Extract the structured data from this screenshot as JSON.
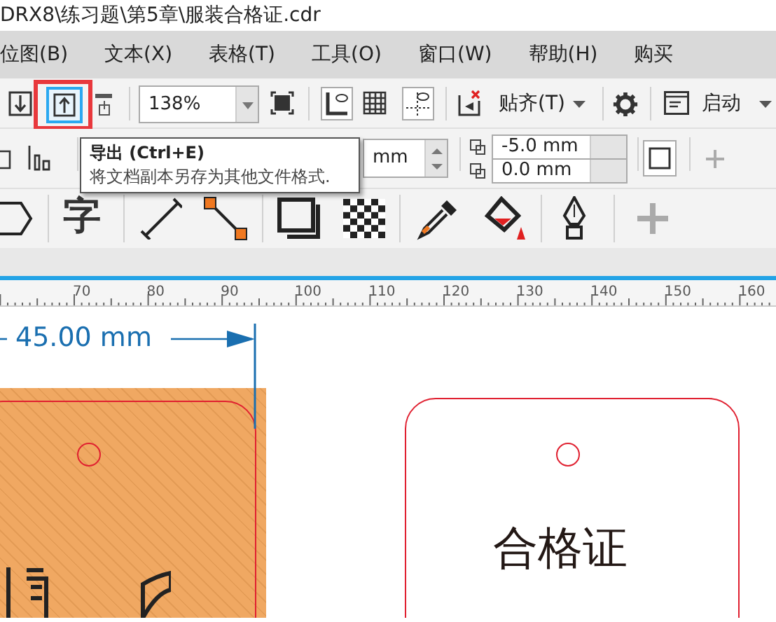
{
  "window": {
    "title": "DRX8\\练习题\\第5章\\服装合格证.cdr"
  },
  "menu": [
    {
      "label": "位图(B)"
    },
    {
      "label": "文本(X)"
    },
    {
      "label": "表格(T)"
    },
    {
      "label": "工具(O)"
    },
    {
      "label": "窗口(W)"
    },
    {
      "label": "帮助(H)"
    },
    {
      "label": "购买"
    }
  ],
  "toolbar": {
    "export_highlighted": true,
    "zoom": "138%",
    "snap": "贴齐(T)",
    "launch": "启动"
  },
  "property_bar": {
    "field_1": "mm",
    "offset_x": "-5.0 mm",
    "offset_y": "0.0 mm"
  },
  "tooltip": {
    "title": "导出 (Ctrl+E)",
    "text": "将文档副本另存为其他文件格式."
  },
  "toolbox": {
    "text_tool": "字"
  },
  "ruler": {
    "labels": [
      "70",
      "80",
      "90",
      "100",
      "110",
      "120",
      "130",
      "140",
      "150",
      "160"
    ]
  },
  "canvas": {
    "dimension": "45.00 mm",
    "tag_title": "合格证"
  }
}
